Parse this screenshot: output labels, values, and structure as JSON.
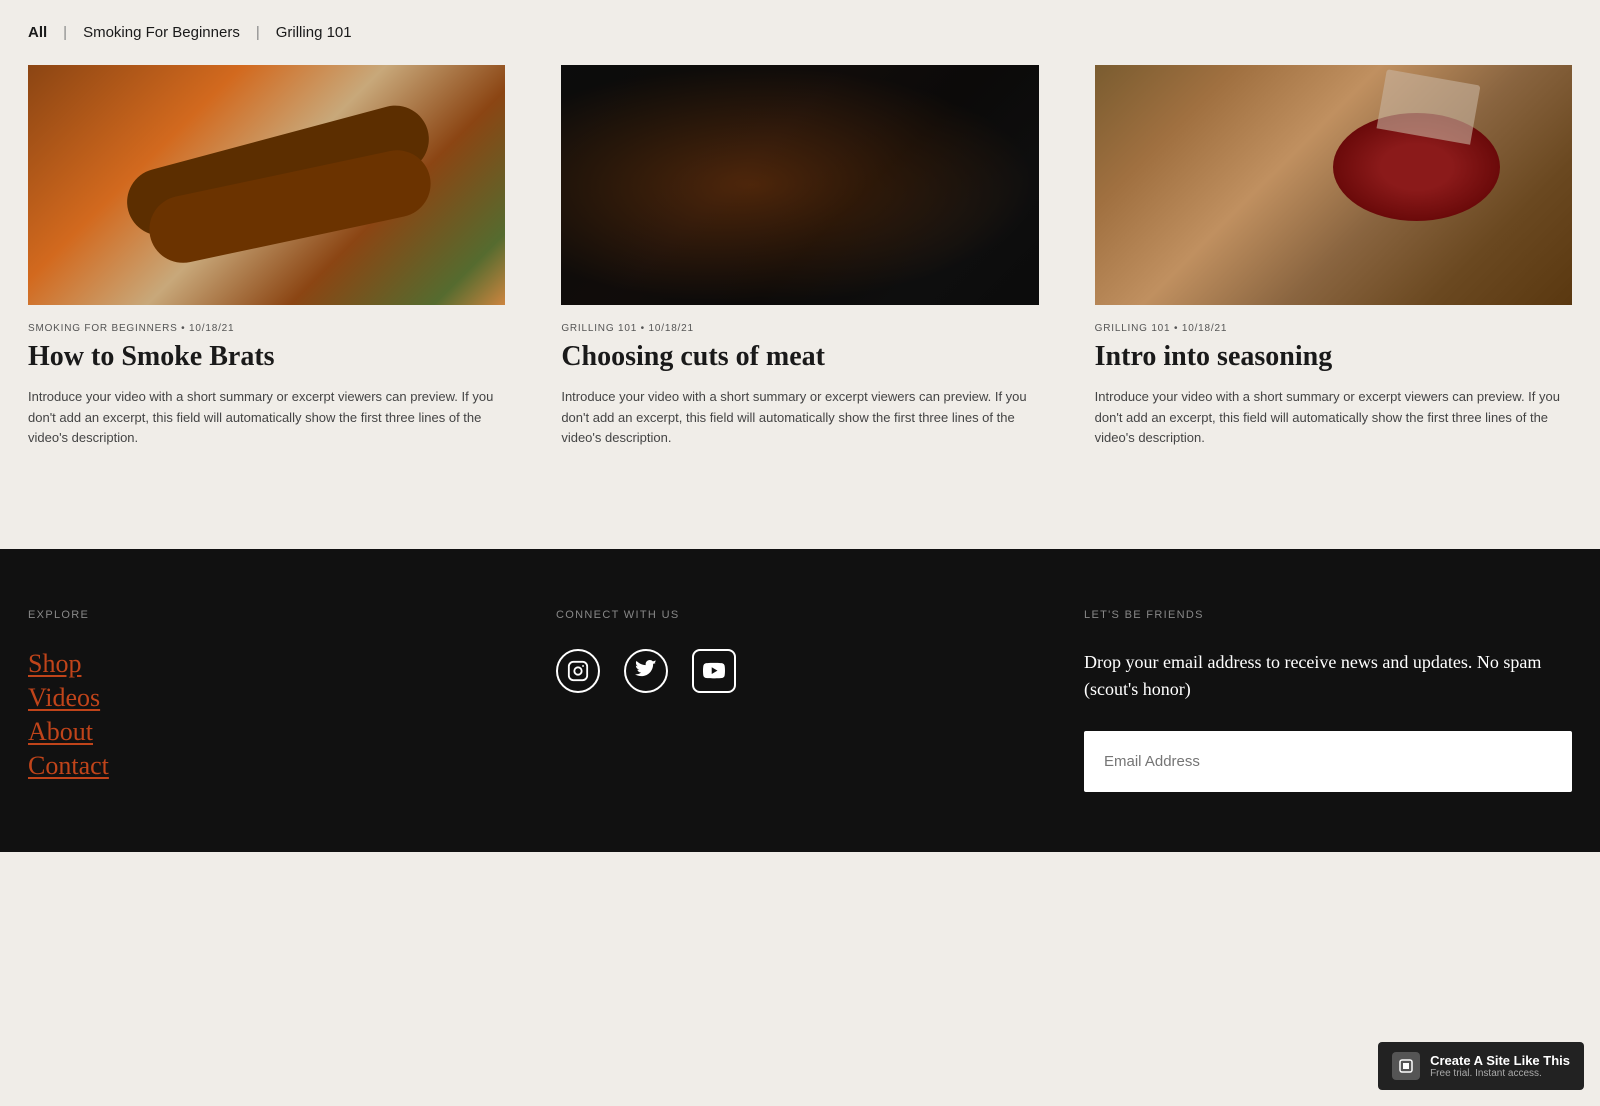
{
  "filter": {
    "all_label": "All",
    "separator1": "|",
    "item1_label": "Smoking For Beginners",
    "separator2": "|",
    "item2_label": "Grilling 101"
  },
  "videos": [
    {
      "category": "SMOKING FOR BEGINNERS • 10/18/21",
      "title": "How to Smoke Brats",
      "excerpt": "Introduce your video with a short summary or excerpt viewers can preview. If you don't add an excerpt, this field will automatically show the first three lines of the video's description.",
      "thumb_type": "sausage"
    },
    {
      "category": "GRILLING 101 • 10/18/21",
      "title": "Choosing cuts of meat",
      "excerpt": "Introduce your video with a short summary or excerpt viewers can preview. If you don't add an excerpt, this field will automatically show the first three lines of the video's description.",
      "thumb_type": "meat"
    },
    {
      "category": "GRILLING 101 • 10/18/21",
      "title": "Intro into seasoning",
      "excerpt": "Introduce your video with a short summary or excerpt viewers can preview. If you don't add an excerpt, this field will automatically show the first three lines of the video's description.",
      "thumb_type": "seasoning"
    }
  ],
  "footer": {
    "explore_label": "EXPLORE",
    "explore_links": [
      "Shop",
      "Videos",
      "About",
      "Contact"
    ],
    "connect_label": "CONNECT WITH US",
    "social_icons": [
      {
        "name": "instagram",
        "symbol": "○"
      },
      {
        "name": "twitter",
        "symbol": "✕"
      },
      {
        "name": "youtube",
        "symbol": "▶"
      }
    ],
    "friends_label": "LET'S BE FRIENDS",
    "newsletter_text": "Drop your email address to receive news and updates. No spam (scout's honor)",
    "email_placeholder": "Email Address"
  },
  "badge": {
    "main": "Create A Site Like This",
    "sub": "Free trial. Instant access."
  }
}
